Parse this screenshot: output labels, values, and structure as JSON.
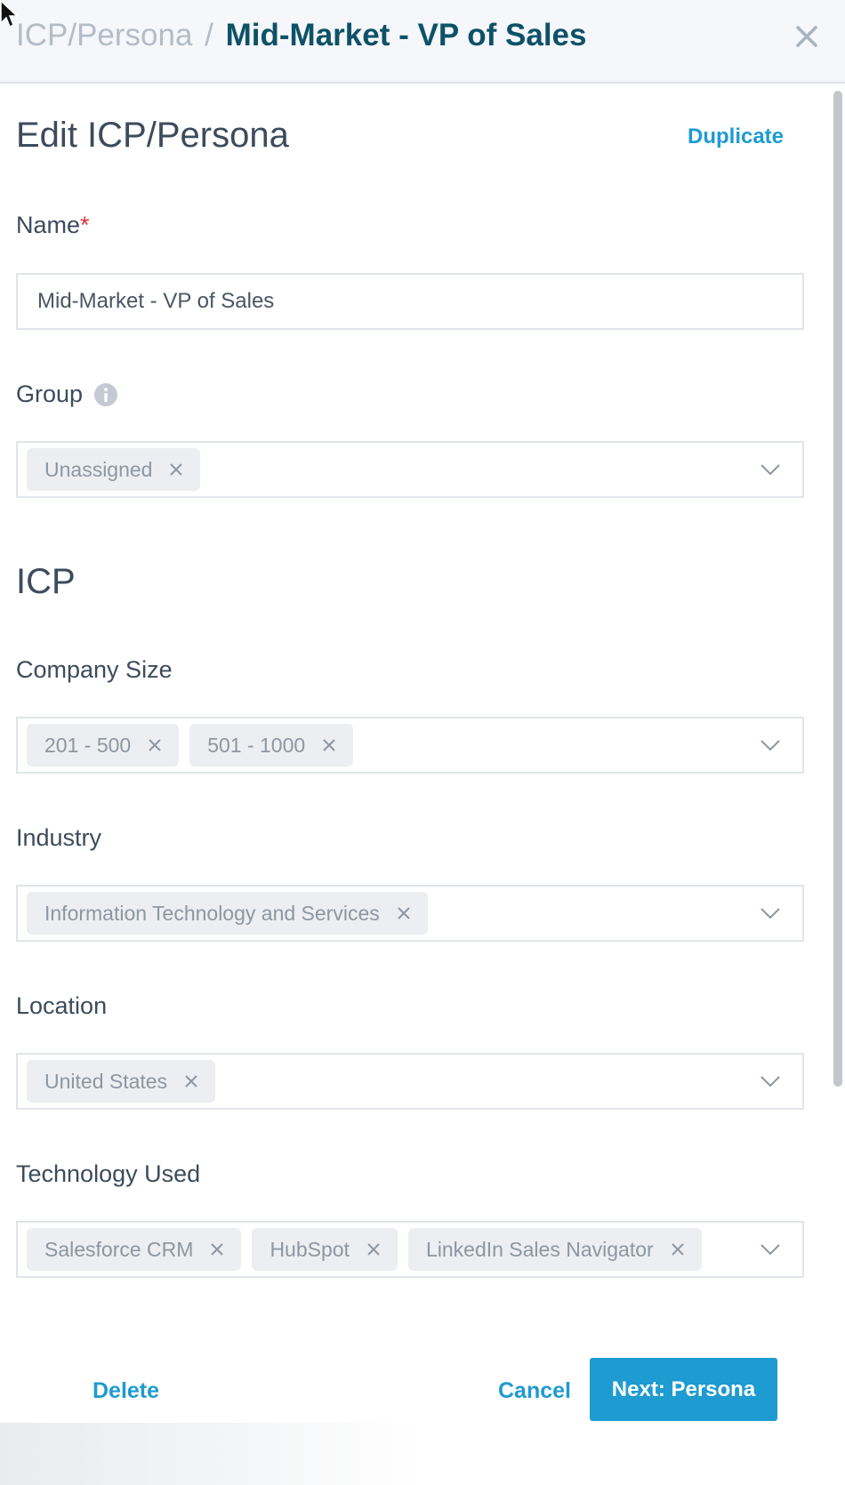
{
  "header": {
    "breadcrumb_parent": "ICP/Persona",
    "breadcrumb_separator": "/",
    "breadcrumb_current": "Mid-Market - VP of Sales"
  },
  "form": {
    "title": "Edit ICP/Persona",
    "duplicate_label": "Duplicate",
    "name": {
      "label": "Name",
      "required_mark": "*",
      "value": "Mid-Market - VP of Sales"
    },
    "group": {
      "label": "Group",
      "chips": [
        "Unassigned"
      ]
    }
  },
  "icp": {
    "section_title": "ICP",
    "company_size": {
      "label": "Company Size",
      "chips": [
        "201 - 500",
        "501 - 1000"
      ]
    },
    "industry": {
      "label": "Industry",
      "chips": [
        "Information Technology and Services"
      ]
    },
    "location": {
      "label": "Location",
      "chips": [
        "United States"
      ]
    },
    "technology_used": {
      "label": "Technology Used",
      "chips": [
        "Salesforce CRM",
        "HubSpot",
        "LinkedIn Sales Navigator"
      ]
    }
  },
  "footer": {
    "delete_label": "Delete",
    "cancel_label": "Cancel",
    "next_label": "Next: Persona"
  },
  "colors": {
    "accent": "#1e9bd0",
    "breadcrumb_current": "#0d5267",
    "required": "#e0333b",
    "chip_bg": "#eceef1"
  },
  "icons": {
    "close": "close-icon",
    "info": "info-icon",
    "chevron": "chevron-down-icon",
    "chip_remove": "remove-chip-icon"
  }
}
